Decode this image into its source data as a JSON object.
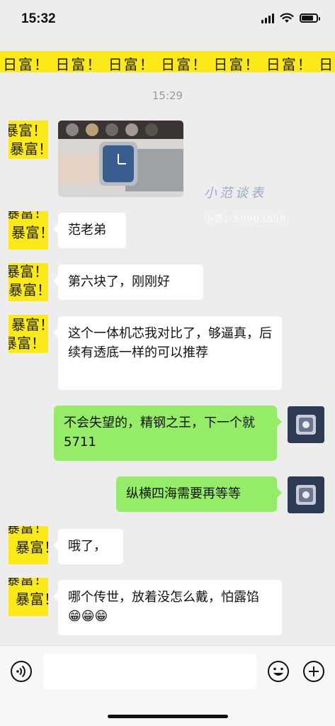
{
  "status": {
    "time": "15:32"
  },
  "banner": {
    "text": "日富！  日富！  日富！  日富！  日富！  日富！  日富！"
  },
  "timestamp": "15:29",
  "watermark": {
    "title": "小范谈表",
    "id": "小范：50603858"
  },
  "contact_avatar": {
    "top": "暴富！",
    "bottom": "暴富！"
  },
  "messages": [
    {
      "side": "left",
      "type": "image"
    },
    {
      "side": "left",
      "type": "text",
      "text": "范老弟"
    },
    {
      "side": "left",
      "type": "text",
      "text": "第六块了，刚刚好"
    },
    {
      "side": "left",
      "type": "text",
      "text": "这个一体机芯我对比了，够逼真，后续有透底一样的可以推荐"
    },
    {
      "side": "right",
      "type": "text",
      "text": "不会失望的，精钢之王，下一个就 5711"
    },
    {
      "side": "right",
      "type": "text",
      "text": "纵横四海需要再等等"
    },
    {
      "side": "left",
      "type": "text",
      "text": "哦了，"
    },
    {
      "side": "left",
      "type": "text",
      "text": "哪个传世，放着没怎么戴，怕露馅😁😁😁"
    }
  ],
  "icons": {
    "voice": "voice-icon",
    "emoji": "emoji-icon",
    "plus": "plus-icon",
    "signal": "signal-icon",
    "wifi": "wifi-icon",
    "battery": "battery-icon"
  },
  "colors": {
    "background": "#ededed",
    "bubble_left": "#ffffff",
    "bubble_right": "#95ec69",
    "avatar_yellow": "#fbe91a"
  },
  "battery_level": 0.8
}
